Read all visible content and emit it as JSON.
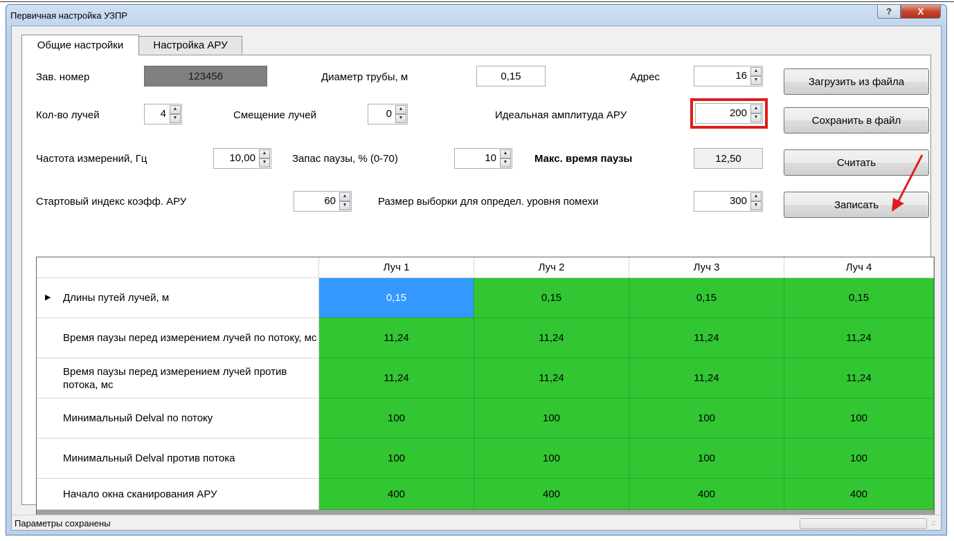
{
  "window": {
    "title": "Первичная настройка УЗПР",
    "help_glyph": "?",
    "close_glyph": "X"
  },
  "tabs": [
    {
      "label": "Общие настройки",
      "active": true
    },
    {
      "label": "Настройка АРУ",
      "active": false
    }
  ],
  "form": {
    "serial": {
      "label": "Зав. номер",
      "value": "123456"
    },
    "pipe_diameter": {
      "label": "Диаметр трубы, м",
      "value": "0,15"
    },
    "address": {
      "label": "Адрес",
      "value": "16"
    },
    "beam_count": {
      "label": "Кол-во лучей",
      "value": "4"
    },
    "beam_offset": {
      "label": "Смещение лучей",
      "value": "0"
    },
    "ideal_amplitude": {
      "label": "Идеальная амплитуда АРУ",
      "value": "200"
    },
    "frequency": {
      "label": "Частота измерений, Гц",
      "value": "10,00"
    },
    "pause_margin": {
      "label": "Запас паузы, % (0-70)",
      "value": "10"
    },
    "max_pause": {
      "label": "Макс. время паузы",
      "value": "12,50"
    },
    "agc_start_index": {
      "label": "Стартовый индекс коэфф. АРУ",
      "value": "60"
    },
    "noise_sample_size": {
      "label": "Размер выборки для определ. уровня помехи",
      "value": "300"
    }
  },
  "spin_arrows": {
    "up": "▲",
    "down": "▼"
  },
  "buttons": {
    "load": "Загрузить из файла",
    "save": "Сохранить в файл",
    "read": "Считать",
    "write": "Записать"
  },
  "table": {
    "columns": [
      "Луч 1",
      "Луч 2",
      "Луч 3",
      "Луч 4"
    ],
    "current_row_marker": "▶",
    "rows": [
      {
        "label": "Длины путей лучей, м",
        "values": [
          "0,15",
          "0,15",
          "0,15",
          "0,15"
        ]
      },
      {
        "label": "Время паузы перед измерением лучей по потоку, мс",
        "values": [
          "11,24",
          "11,24",
          "11,24",
          "11,24"
        ]
      },
      {
        "label": "Время паузы перед измерением лучей против потока, мс",
        "values": [
          "11,24",
          "11,24",
          "11,24",
          "11,24"
        ]
      },
      {
        "label": "Минимальный Delval по потоку",
        "values": [
          "100",
          "100",
          "100",
          "100"
        ]
      },
      {
        "label": "Минимальный Delval против потока",
        "values": [
          "100",
          "100",
          "100",
          "100"
        ]
      },
      {
        "label": "Начало окна сканирования АРУ",
        "values": [
          "400",
          "400",
          "400",
          "400"
        ]
      }
    ]
  },
  "status": {
    "text": "Параметры сохранены",
    "grip": ".::"
  },
  "colors": {
    "cell_ok": "#33c633",
    "cell_selected": "#3399ff",
    "highlight": "#e01c1c",
    "annotation_arrow": "#e01c1c"
  }
}
